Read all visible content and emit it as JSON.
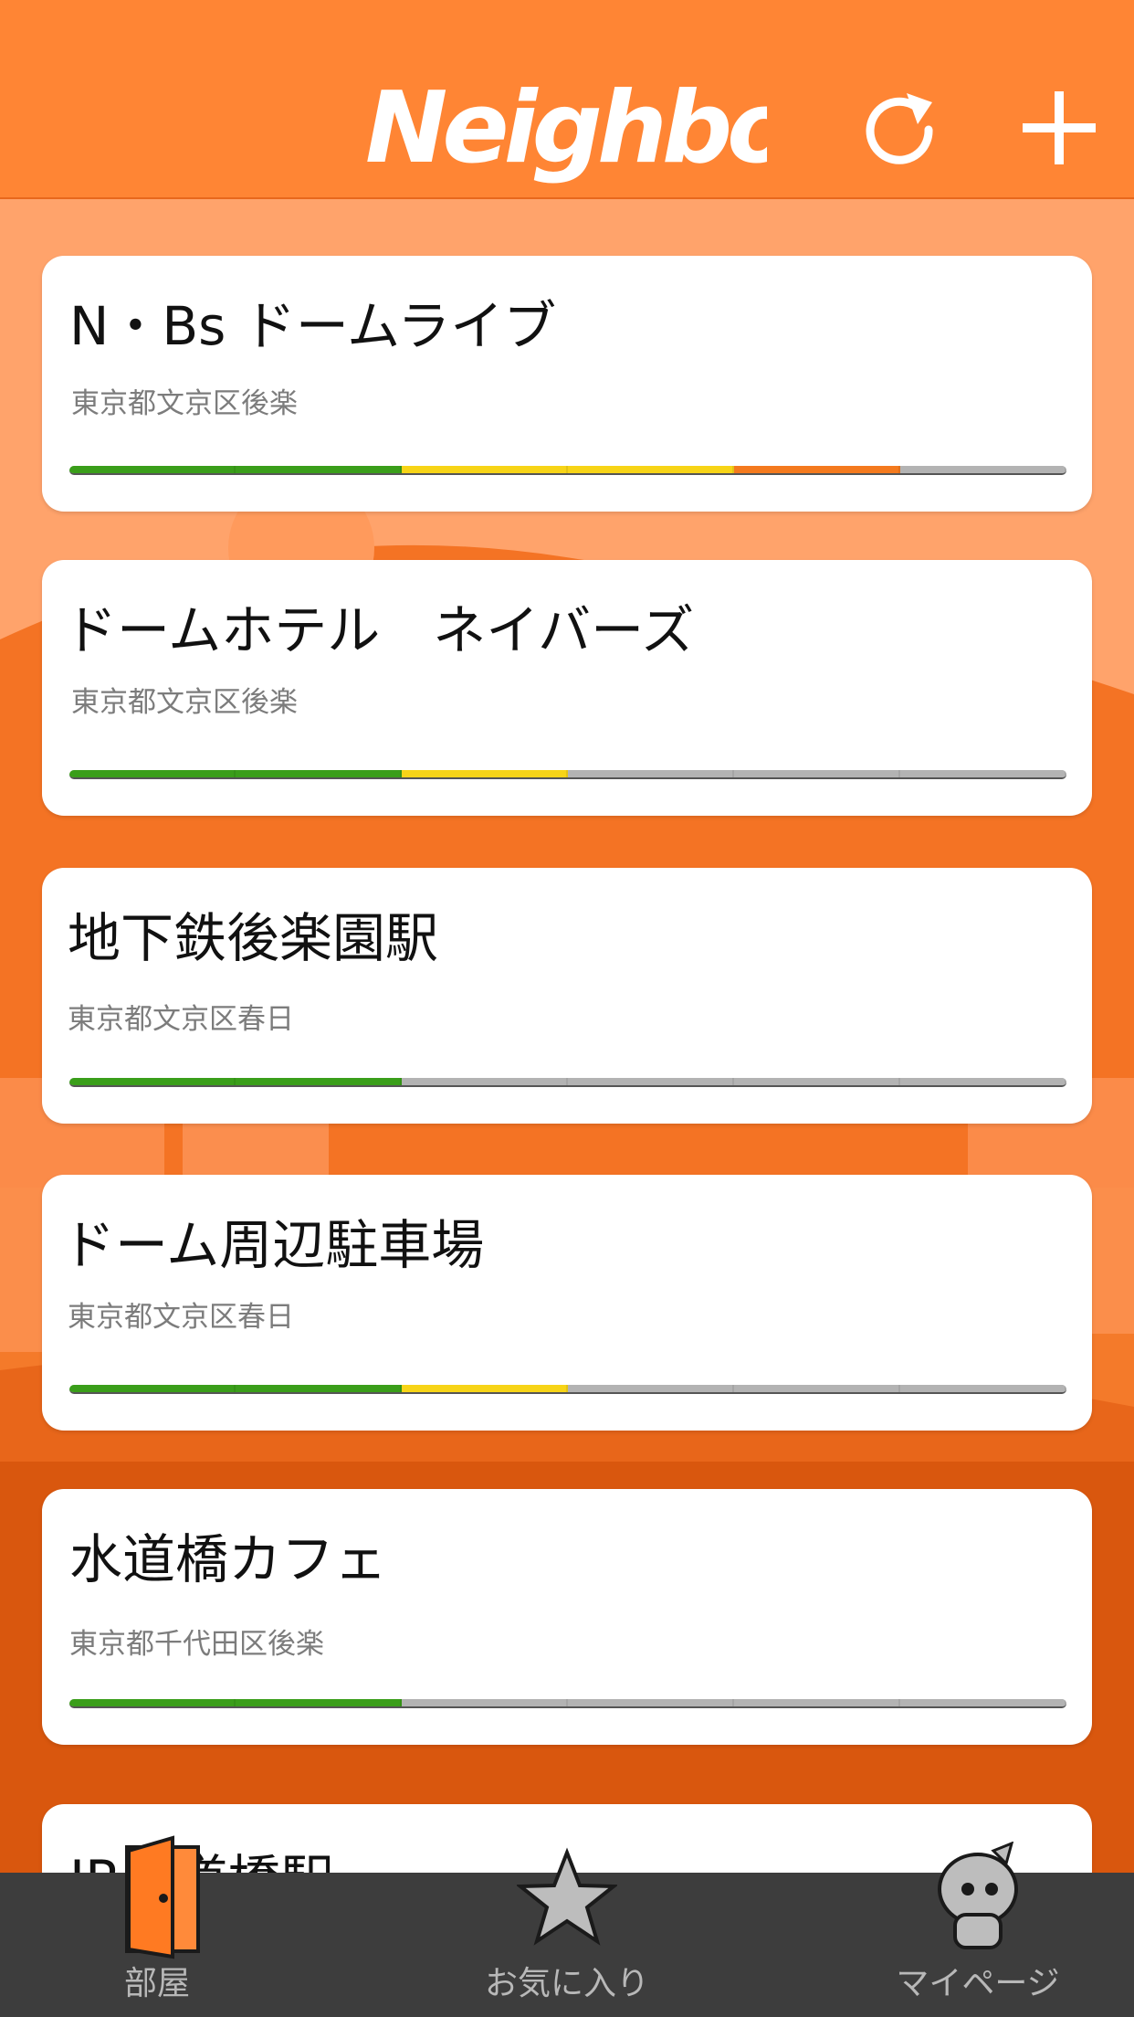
{
  "header": {
    "logo_text": "Neighbors",
    "refresh_icon": "refresh-icon",
    "add_icon": "plus-icon"
  },
  "colors": {
    "header": "#ff8534",
    "green": "#3a9e1a",
    "yellow": "#f7d417",
    "orange": "#f47a1e",
    "gray": "#b3b3b3"
  },
  "rooms": [
    {
      "title": "N・Bs ドームライブ",
      "address": "東京都文京区後楽",
      "levels": [
        "green",
        "green",
        "yellow",
        "yellow",
        "orange",
        "gray"
      ]
    },
    {
      "title": "ドームホテル　ネイバーズ",
      "address": "東京都文京区後楽",
      "levels": [
        "green",
        "green",
        "yellow",
        "gray",
        "gray",
        "gray"
      ]
    },
    {
      "title": "地下鉄後楽園駅",
      "address": "東京都文京区春日",
      "levels": [
        "green",
        "green",
        "gray",
        "gray",
        "gray",
        "gray"
      ]
    },
    {
      "title": "ドーム周辺駐車場",
      "address": "東京都文京区春日",
      "levels": [
        "green",
        "green",
        "yellow",
        "gray",
        "gray",
        "gray"
      ]
    },
    {
      "title": "水道橋カフェ",
      "address": "東京都千代田区後楽",
      "levels": [
        "green",
        "green",
        "gray",
        "gray",
        "gray",
        "gray"
      ]
    },
    {
      "title": "JR水道橋駅",
      "address": "",
      "levels": []
    }
  ],
  "tabs": [
    {
      "label": "部屋",
      "icon": "door-icon"
    },
    {
      "label": "お気に入り",
      "icon": "star-icon"
    },
    {
      "label": "マイページ",
      "icon": "mascot-icon"
    }
  ]
}
